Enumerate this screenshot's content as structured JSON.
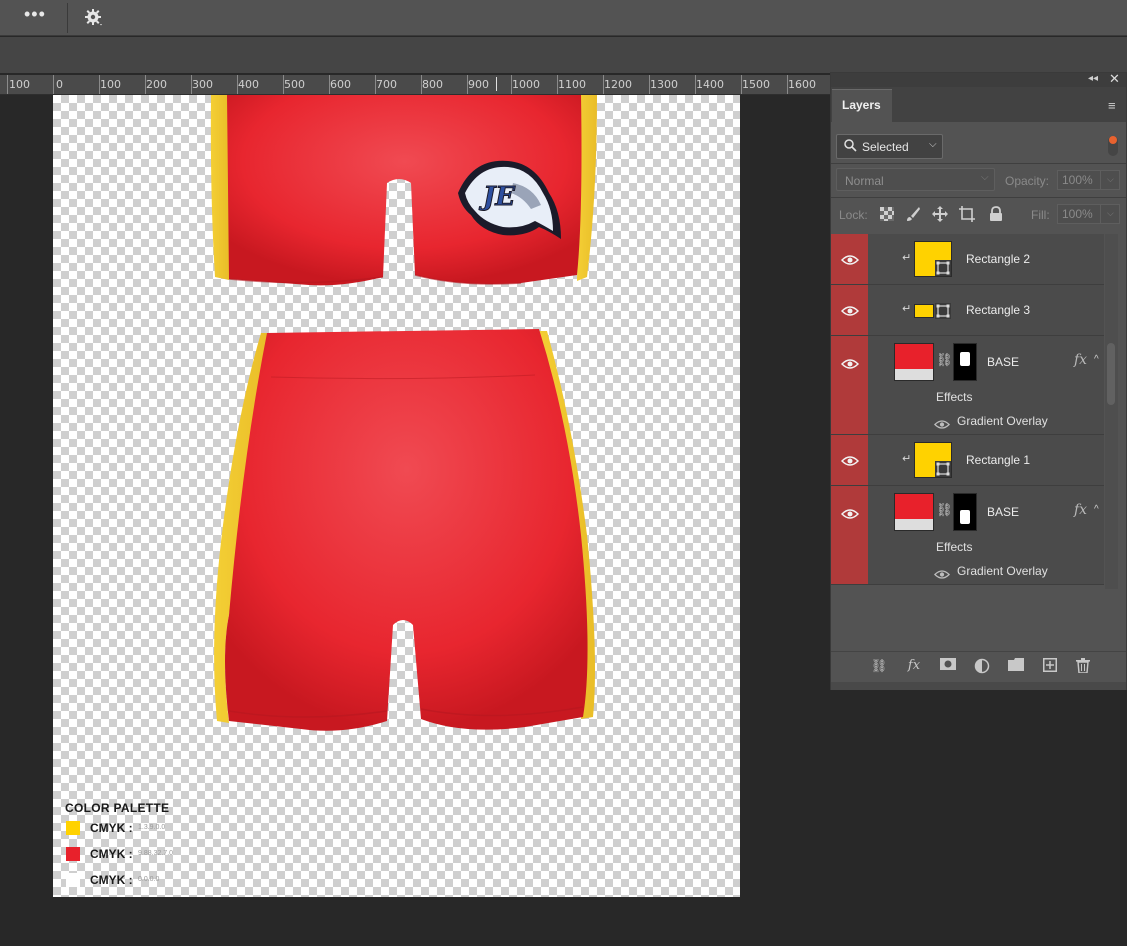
{
  "toolbar": {
    "more_label": "•••",
    "settings_icon": "gear-icon"
  },
  "ruler": {
    "labels": [
      "100",
      "0",
      "100",
      "200",
      "300",
      "400",
      "500",
      "600",
      "700",
      "800",
      "900",
      "1000",
      "1100",
      "1200",
      "1300",
      "1400",
      "1500",
      "1600"
    ]
  },
  "artwork": {
    "logo_text": "JE",
    "palette": {
      "title": "COLOR PALETTE",
      "rows": [
        {
          "label": "CMYK :",
          "value": "1.3.9.0.0",
          "color": "#FFD200"
        },
        {
          "label": "CMYK :",
          "value": "9.88.32.7.0",
          "color": "#E8212B"
        },
        {
          "label": "CMYK :",
          "value": "0.0.0.0",
          "color": "#FFFFFF"
        }
      ]
    }
  },
  "layers_panel": {
    "tab_label": "Layers",
    "filter": {
      "value": "Selected"
    },
    "blend_mode": "Normal",
    "opacity_label": "Opacity:",
    "opacity_value": "100%",
    "lock_label": "Lock:",
    "fill_label": "Fill:",
    "fill_value": "100%",
    "layers": [
      {
        "name": "Rectangle 2",
        "color": "#FFD200"
      },
      {
        "name": "Rectangle 3",
        "color": "#FFD200"
      },
      {
        "name": "BASE",
        "color": "#E8212B",
        "effects_label": "Effects",
        "effect": "Gradient Overlay"
      },
      {
        "name": "Rectangle 1",
        "color": "#FFD200"
      },
      {
        "name": "BASE",
        "color": "#E8212B",
        "effects_label": "Effects",
        "effect": "Gradient Overlay"
      }
    ],
    "colors": {
      "eye_column": "#B03A3A",
      "accent": "#E8622F"
    }
  }
}
